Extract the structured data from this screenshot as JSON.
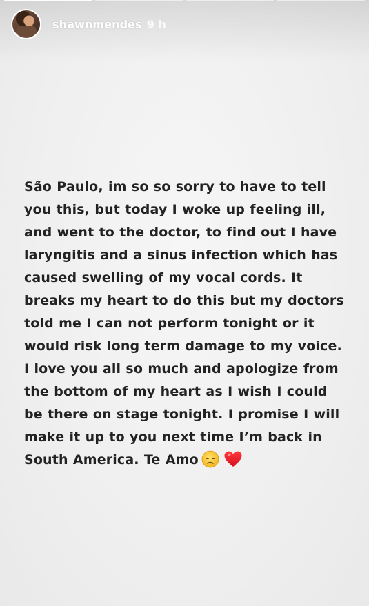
{
  "story": {
    "username": "shawnmendes",
    "time": "9 h",
    "progress_segments": 4,
    "active_segment": 0
  },
  "message": {
    "lines": [
      "São Paulo, im so so sorry to have to tell",
      "you this, but today I woke up feeling ill,",
      "and went to the doctor, to find out I have",
      "laryngitis and a sinus infection which has",
      "caused swelling of my vocal cords. It",
      "breaks my heart to do this but my doctors",
      "told me I can not perform tonight or it",
      "would risk long term damage to my voice.",
      "I love you all so much and apologize from",
      "the bottom of my heart as I wish I could",
      "be there on stage tonight. I promise I will",
      "make it up to you next time I’m back in",
      "South America. Te Amo"
    ],
    "emojis": [
      "disappointed-face",
      "red-heart"
    ]
  },
  "colors": {
    "background": "#f1f1f1",
    "text": "#222222",
    "header_text": "#ffffff"
  }
}
